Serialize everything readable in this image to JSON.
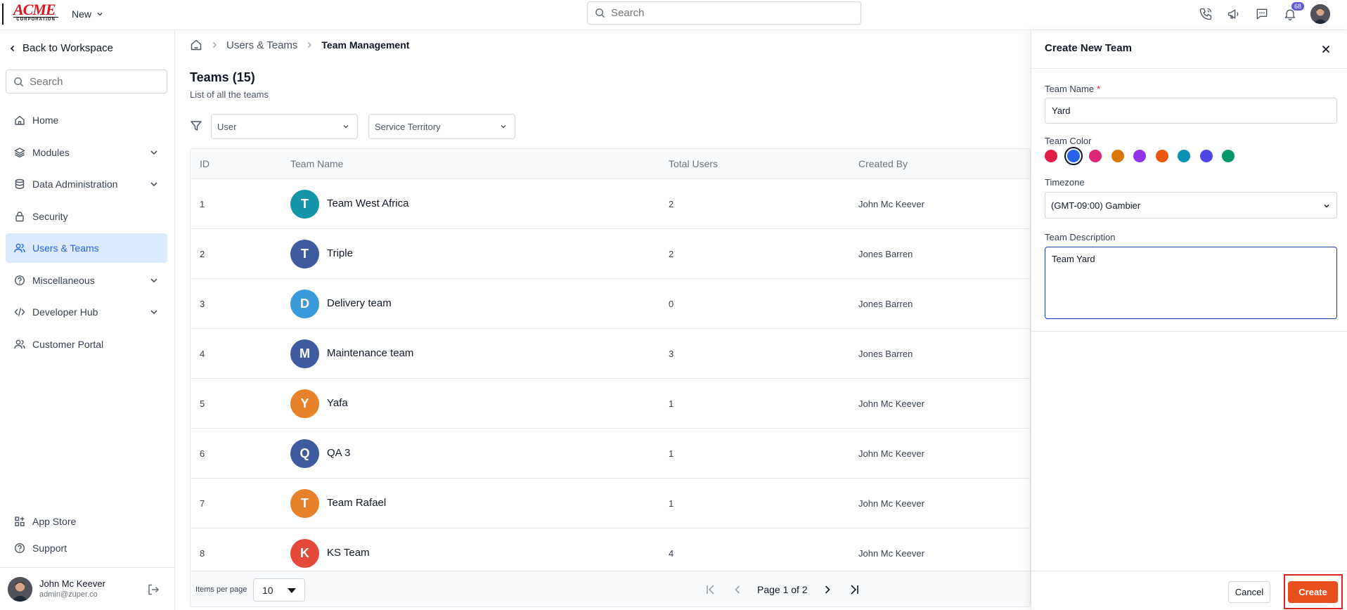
{
  "topbar": {
    "logo_main": "ACME",
    "logo_sub": "CORPORATION",
    "new_label": "New",
    "search_placeholder": "Search",
    "notification_count": "68"
  },
  "sidebar": {
    "back_label": "Back to Workspace",
    "search_placeholder": "Search",
    "items": [
      {
        "label": "Home",
        "icon": "home-icon",
        "expandable": false
      },
      {
        "label": "Modules",
        "icon": "layers-icon",
        "expandable": true
      },
      {
        "label": "Data Administration",
        "icon": "database-icon",
        "expandable": true
      },
      {
        "label": "Security",
        "icon": "lock-icon",
        "expandable": false
      },
      {
        "label": "Users & Teams",
        "icon": "users-icon",
        "expandable": false,
        "active": true
      },
      {
        "label": "Miscellaneous",
        "icon": "help-circle-icon",
        "expandable": true
      },
      {
        "label": "Developer Hub",
        "icon": "code-icon",
        "expandable": true
      },
      {
        "label": "Customer Portal",
        "icon": "users-icon",
        "expandable": false
      }
    ],
    "bottom_items": [
      {
        "label": "App Store",
        "icon": "grid-icon"
      },
      {
        "label": "Support",
        "icon": "help-circle-icon"
      }
    ],
    "user": {
      "name": "John Mc Keever",
      "email": "admin@zuper.co"
    }
  },
  "breadcrumb": {
    "section": "Users & Teams",
    "current": "Team Management"
  },
  "page": {
    "title": "Teams (15)",
    "subtitle": "List of all the teams"
  },
  "filters": {
    "user": "User",
    "territory": "Service Territory"
  },
  "table": {
    "columns": [
      "ID",
      "Team Name",
      "Total Users",
      "Created By"
    ],
    "rows": [
      {
        "id": "1",
        "initial": "T",
        "color": "#1596a8",
        "name": "Team West Africa",
        "users": "2",
        "created_by": "John Mc Keever"
      },
      {
        "id": "2",
        "initial": "T",
        "color": "#3f5b9f",
        "name": "Triple",
        "users": "2",
        "created_by": "Jones Barren"
      },
      {
        "id": "3",
        "initial": "D",
        "color": "#3a9ad9",
        "name": "Delivery team",
        "users": "0",
        "created_by": "Jones Barren"
      },
      {
        "id": "4",
        "initial": "M",
        "color": "#3f5b9f",
        "name": "Maintenance team",
        "users": "3",
        "created_by": "Jones Barren"
      },
      {
        "id": "5",
        "initial": "Y",
        "color": "#e8822a",
        "name": "Yafa",
        "users": "1",
        "created_by": "John Mc Keever"
      },
      {
        "id": "6",
        "initial": "Q",
        "color": "#3f5b9f",
        "name": "QA 3",
        "users": "1",
        "created_by": "John Mc Keever"
      },
      {
        "id": "7",
        "initial": "T",
        "color": "#e8822a",
        "name": "Team Rafael",
        "users": "1",
        "created_by": "John Mc Keever"
      },
      {
        "id": "8",
        "initial": "K",
        "color": "#e4493a",
        "name": "KS Team",
        "users": "4",
        "created_by": "John Mc Keever"
      }
    ],
    "footer": {
      "items_per_page_label": "Items per page",
      "items_per_page": "10",
      "page_text": "Page 1 of 2"
    }
  },
  "drawer": {
    "title": "Create New Team",
    "name_label": "Team Name",
    "name_value": "Yard",
    "color_label": "Team Color",
    "colors": [
      "#e11d48",
      "#2563eb",
      "#db2777",
      "#d97706",
      "#9333ea",
      "#ea580c",
      "#0891b2",
      "#4f46e5",
      "#059669"
    ],
    "selected_color_index": 1,
    "timezone_label": "Timezone",
    "timezone_value": "(GMT-09:00) Gambier",
    "description_label": "Team Description",
    "description_value": "Team Yard",
    "cancel_label": "Cancel",
    "create_label": "Create"
  }
}
